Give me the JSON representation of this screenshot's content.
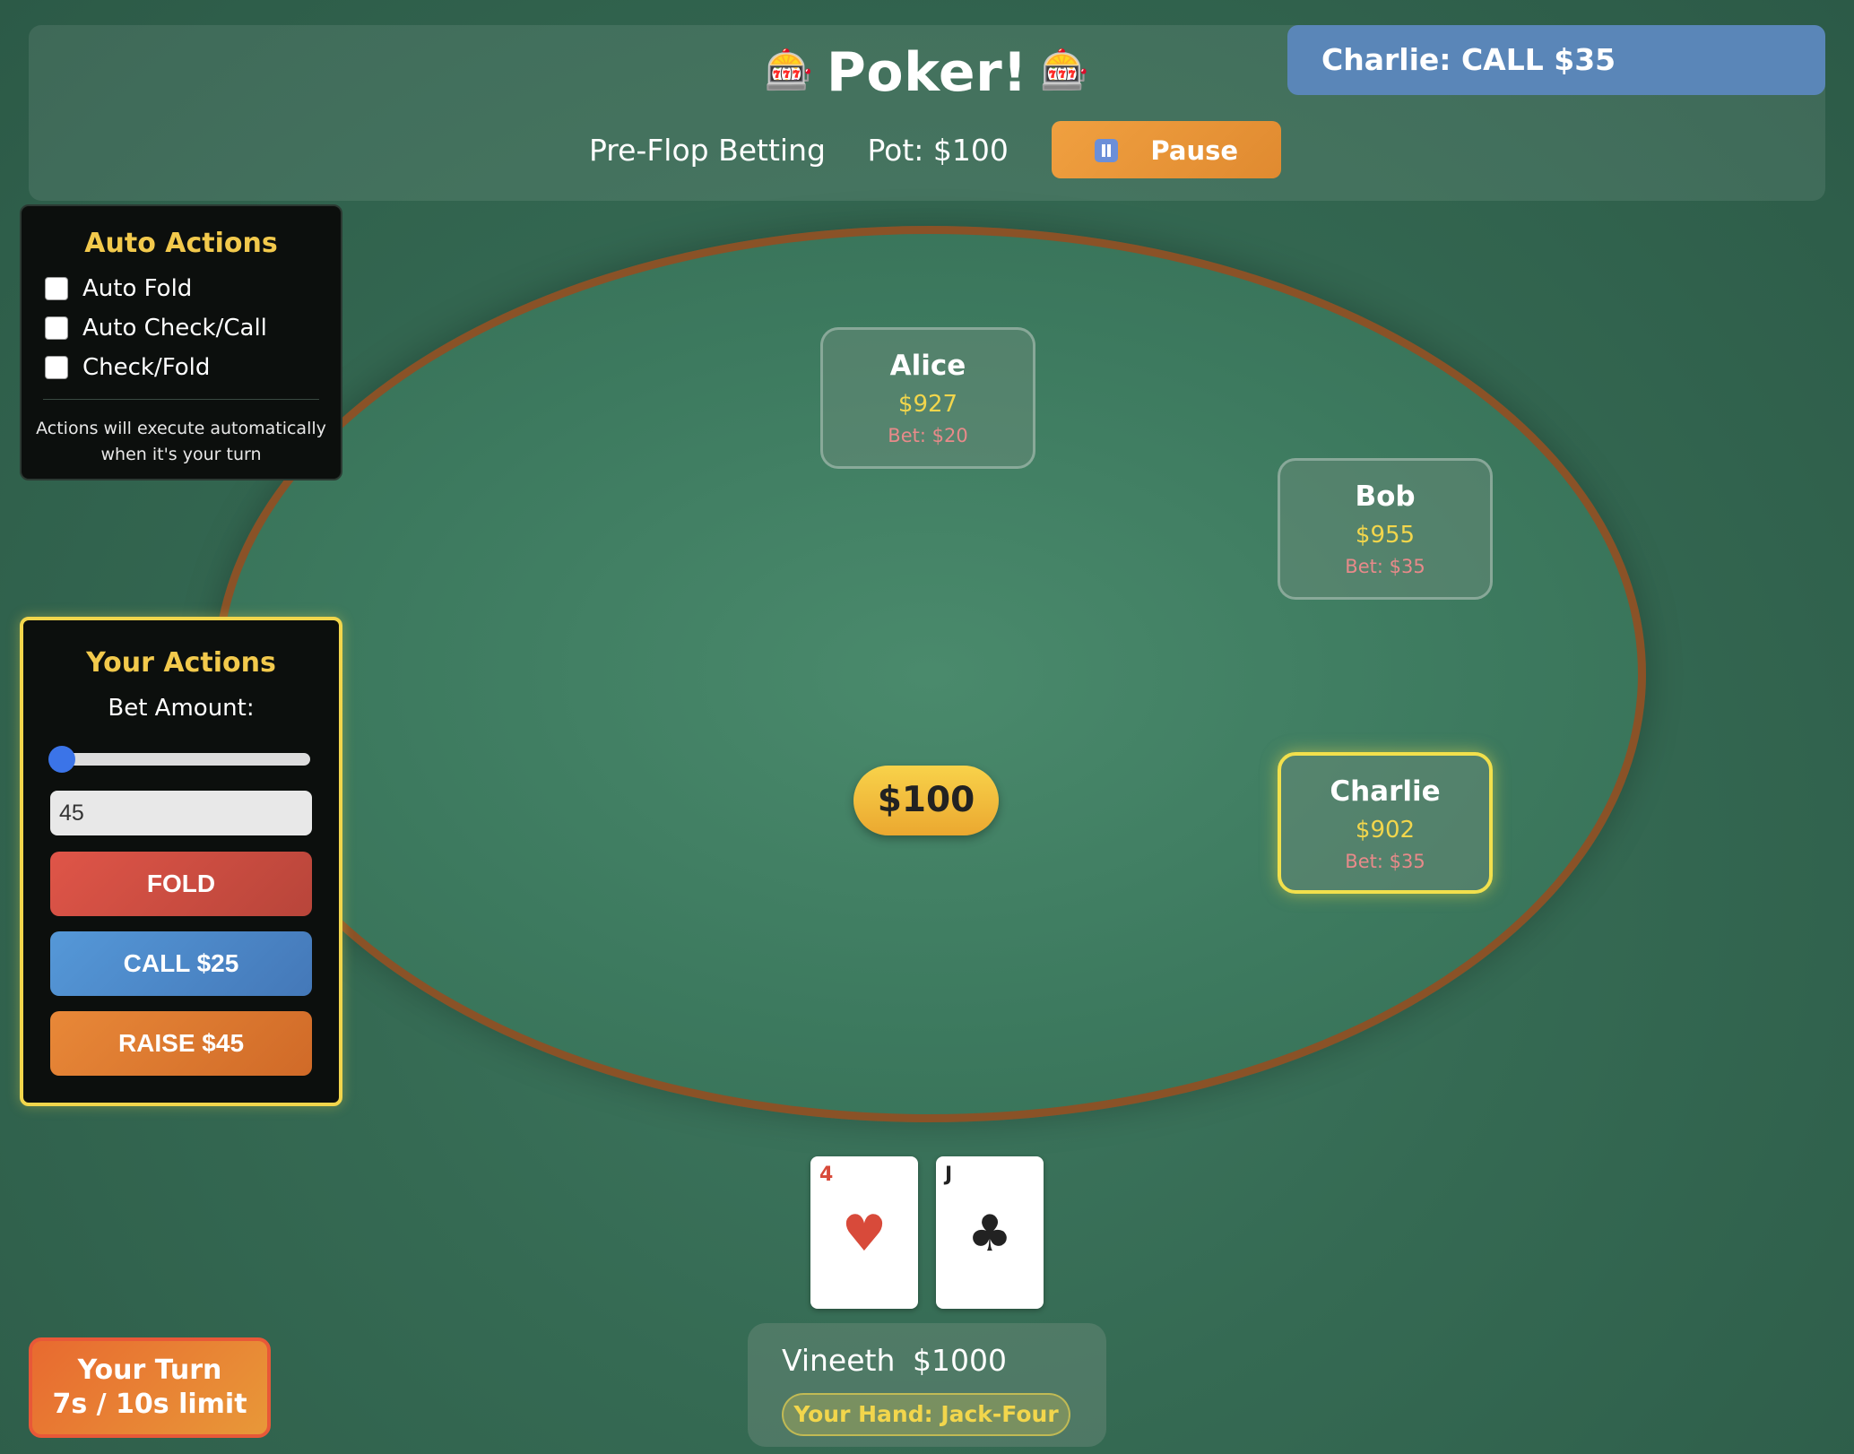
{
  "header": {
    "title": "Poker!",
    "title_icon": "slot-machine-icon",
    "phase": "Pre-Flop Betting",
    "pot_label": "Pot: $100",
    "pause_label": "Pause"
  },
  "notification": {
    "text": "Charlie: CALL $35"
  },
  "auto_actions": {
    "title": "Auto Actions",
    "options": [
      {
        "label": "Auto Fold",
        "checked": false
      },
      {
        "label": "Auto Check/Call",
        "checked": false
      },
      {
        "label": "Check/Fold",
        "checked": false
      }
    ],
    "hint_line1": "Actions will execute automatically",
    "hint_line2": "when it's your turn"
  },
  "your_actions": {
    "title": "Your Actions",
    "bet_label": "Bet Amount:",
    "slider_value_fraction": 0.0,
    "bet_value": "45",
    "fold_label": "FOLD",
    "call_label": "CALL $25",
    "raise_label": "RAISE $45"
  },
  "players": [
    {
      "name": "Alice",
      "chips": "$927",
      "bet": "Bet: $20",
      "active": false
    },
    {
      "name": "Bob",
      "chips": "$955",
      "bet": "Bet: $35",
      "active": false
    },
    {
      "name": "Charlie",
      "chips": "$902",
      "bet": "Bet: $35",
      "active": true
    }
  ],
  "pot": {
    "amount": "$100"
  },
  "hand": {
    "cards": [
      {
        "rank": "4",
        "suit": "♥",
        "color": "red",
        "suit_name": "hearts-icon"
      },
      {
        "rank": "J",
        "suit": "♣",
        "color": "black",
        "suit_name": "clubs-icon"
      }
    ],
    "player_name": "Vineeth",
    "player_chips": "$1000",
    "hand_label": "Your Hand: Jack-Four"
  },
  "turn_timer": {
    "line1": "Your Turn",
    "line2": "7s / 10s limit"
  },
  "colors": {
    "accent_yellow": "#f2d64c",
    "fold": "#df5548",
    "call": "#5598d8",
    "raise": "#e88838",
    "table_rim": "#8a5227"
  }
}
